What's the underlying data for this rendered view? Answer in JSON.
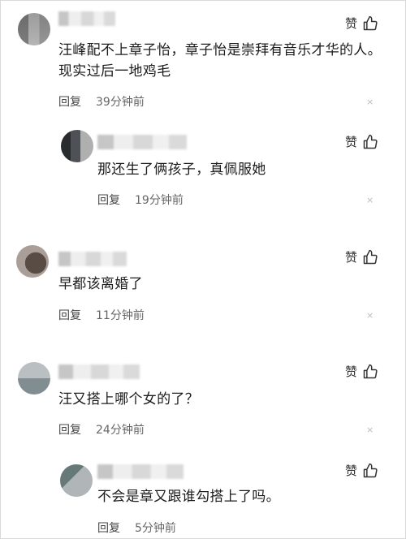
{
  "like_label": "赞",
  "reply_label": "回复",
  "close_glyph": "×",
  "comments": [
    {
      "text_line1": "汪峰配不上章子怡，章子怡是崇拜有音乐才华的人。",
      "text_line2": "现实过后一地鸡毛",
      "time": "39分钟前"
    },
    {
      "text_line1": "那还生了俩孩子，真佩服她",
      "time": "19分钟前"
    },
    {
      "text_line1": "早都该离婚了",
      "time": "11分钟前"
    },
    {
      "text_line1": "汪又搭上哪个女的了？",
      "time": "24分钟前"
    },
    {
      "text_line1": "不会是章又跟谁勾搭上了吗。",
      "time": "5分钟前"
    }
  ]
}
